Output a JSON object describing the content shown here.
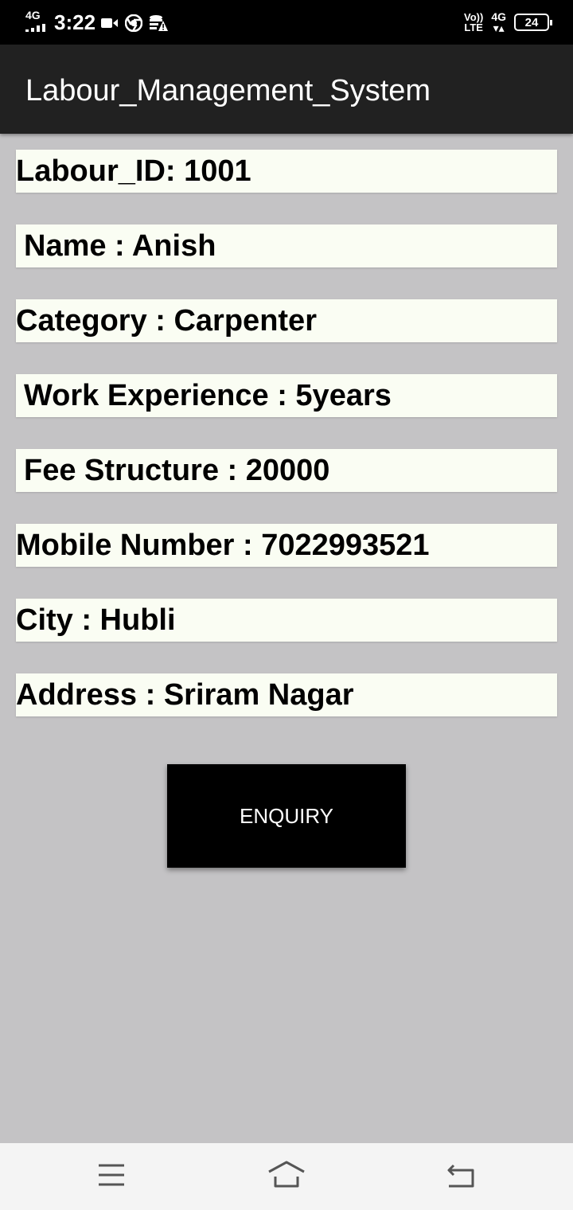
{
  "status_bar": {
    "network_left": "4G",
    "time": "3:22",
    "volte": "Vo)) LTE",
    "network_right": "4G",
    "battery": "24",
    "icons": [
      "signal-icon",
      "video-camera-icon",
      "chrome-icon",
      "data-warning-icon",
      "battery-icon"
    ]
  },
  "app_bar": {
    "title": "Labour_Management_System"
  },
  "details": {
    "labour_id": "Labour_ID: 1001",
    "name": "Name : Anish",
    "category": "Category : Carpenter",
    "work_experience": "Work Experience : 5years",
    "fee_structure": "Fee Structure : 20000",
    "mobile_number": "Mobile Number : 7022993521",
    "city": "City : Hubli",
    "address": "Address : Sriram Nagar"
  },
  "actions": {
    "enquiry_label": "ENQUIRY"
  },
  "nav_bar": {
    "icons": [
      "menu-icon",
      "home-icon",
      "back-icon"
    ]
  },
  "colors": {
    "status_bar": "#000000",
    "app_bar": "#212121",
    "background": "#c4c3c5",
    "field_background": "#fafdf3",
    "button": "#000000",
    "nav_bar": "#f4f4f4"
  }
}
